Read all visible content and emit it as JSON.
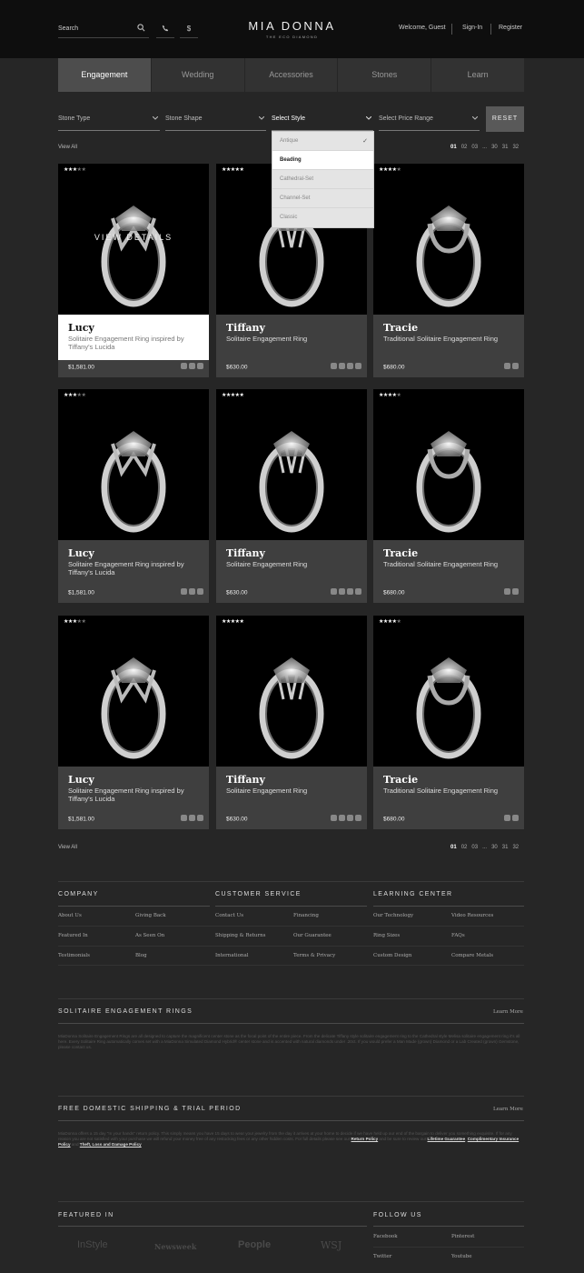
{
  "header": {
    "search_placeholder": "Search",
    "currency_symbol": "$",
    "logo_main": "MIA DONNA",
    "logo_sub": "THE ECO DIAMOND",
    "welcome": "Welcome, Guest",
    "signin": "Sign-In",
    "register": "Register"
  },
  "nav": {
    "tabs": [
      "Engagement",
      "Wedding",
      "Accessories",
      "Stones",
      "Learn"
    ],
    "active": "Engagement"
  },
  "filters": {
    "stone_type": "Stone Type",
    "stone_shape": "Stone Shape",
    "style": "Select Style",
    "price_range": "Select Price Range",
    "reset": "RESET",
    "style_options": [
      "Antique",
      "Beading",
      "Cathedral-Set",
      "Channel-Set",
      "Classic"
    ],
    "style_checked": "Antique",
    "style_highlighted": "Beading"
  },
  "listing": {
    "view_all": "View All",
    "pages": [
      "01",
      "02",
      "03",
      "...",
      "30",
      "31",
      "32"
    ],
    "current_page": "01",
    "view_details": "VIEW DETAILS",
    "products": [
      {
        "name": "Lucy",
        "desc": "Solitaire Engagement Ring inspired by Tiffany's Lucida",
        "price": "$1,581.00",
        "rating": 3,
        "prongs": "v"
      },
      {
        "name": "Tiffany",
        "desc": "Solitaire Engagement Ring",
        "price": "$630.00",
        "rating": 5,
        "prongs": "t"
      },
      {
        "name": "Tracie",
        "desc": "Traditional Solitaire Engagement Ring",
        "price": "$680.00",
        "rating": 4,
        "prongs": "u"
      },
      {
        "name": "Lucy",
        "desc": "Solitaire Engagement Ring inspired by Tiffany's Lucida",
        "price": "$1,581.00",
        "rating": 3,
        "prongs": "v"
      },
      {
        "name": "Tiffany",
        "desc": "Solitaire Engagement Ring",
        "price": "$630.00",
        "rating": 5,
        "prongs": "t"
      },
      {
        "name": "Tracie",
        "desc": "Traditional Solitaire Engagement Ring",
        "price": "$680.00",
        "rating": 4,
        "prongs": "u"
      },
      {
        "name": "Lucy",
        "desc": "Solitaire Engagement Ring inspired by Tiffany's Lucida",
        "price": "$1,581.00",
        "rating": 3,
        "prongs": "v"
      },
      {
        "name": "Tiffany",
        "desc": "Solitaire Engagement Ring",
        "price": "$630.00",
        "rating": 5,
        "prongs": "t"
      },
      {
        "name": "Tracie",
        "desc": "Traditional Solitaire Engagement Ring",
        "price": "$680.00",
        "rating": 4,
        "prongs": "u"
      }
    ]
  },
  "footer": {
    "company": {
      "title": "COMPANY",
      "links": [
        "About Us",
        "Giving Back",
        "Featured In",
        "As Seen On",
        "Testimonials",
        "Blog"
      ]
    },
    "service": {
      "title": "CUSTOMER SERVICE",
      "links": [
        "Contact Us",
        "Financing",
        "Shipping & Returns",
        "Our Guarantee",
        "International",
        "Terms & Privacy"
      ]
    },
    "learning": {
      "title": "LEARNING CENTER",
      "links": [
        "Our Technology",
        "Video Resources",
        "Ring Sizes",
        "FAQs",
        "Custom Design",
        "Compare Metals"
      ]
    },
    "solitaire": {
      "title": "SOLITAIRE ENGAGEMENT RINGS",
      "learn_more": "Learn More",
      "text": "MiaDonna Solitaire Engagement Rings are all designed to capture the magnificent center stone as the focal point of the entire piece. From the delicate Tiffany style solitaire engagement ring to the Cathedral style Melisa solitaire engagement ring it's all here. Every Solitaire Ring automatically comes set with a MiaDonna Simulated Diamond Hybrid® center stone and is accented with natural diamonds under .20ct. If you would prefer a Man Made (grown) Diamond or a Lab Created (grown) Gemstone, please contact us."
    },
    "shipping": {
      "title": "FREE DOMESTIC SHIPPING & TRIAL PERIOD",
      "learn_more": "Learn More",
      "text": "MiaDonna offers a 15 day \"In your hands\" return policy. This simply means you have 15 days to wear your jewelry from the day it arrives at your home to decide if we have held up our end of the bargain to deliver you something exquisite. If for any reason you are not satisfied with your purchase we will refund your money free of any restocking fees or any other hidden costs. For full details please see our",
      "link_return": "Return Policy",
      "text2": "and be sure to review our",
      "link_lifetime": "Lifetime Guarantee",
      "link_insurance": "Complimentary Insurance Policy",
      "and": "and",
      "link_theft": "Theft, Loss and Damage Policy"
    },
    "featured": {
      "title": "FEATURED IN",
      "logos": [
        "InStyle",
        "Newsweek",
        "People",
        "WSJ"
      ]
    },
    "follow": {
      "title": "FOLLOW US",
      "links": [
        "Facebook",
        "Pinterest",
        "Twitter",
        "Youtube"
      ]
    }
  }
}
